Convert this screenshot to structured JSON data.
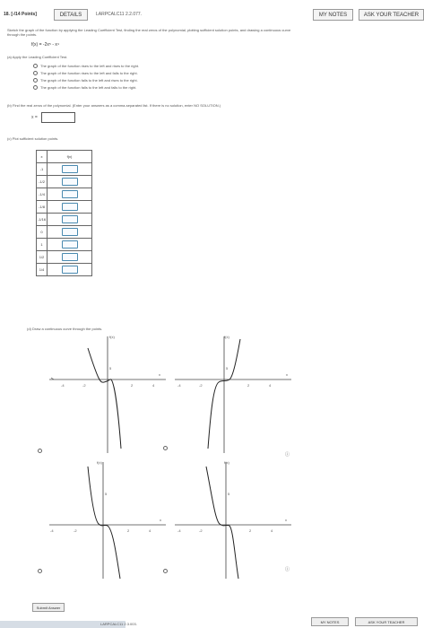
{
  "header": {
    "question_number": "18. [-/14 Points]",
    "details_label": "DETAILS",
    "problem_id": "LARPCALC11 2.2.077.",
    "my_notes_label": "MY NOTES",
    "ask_teacher_label": "ASK YOUR TEACHER"
  },
  "prompt": {
    "line1": "Sketch the graph of the function by applying the Leading Coefficient Test, finding the real zeros of the polynomial, plotting sufficient solution points, and drawing a continuous curve",
    "line2": "through the points.",
    "function": "f(x) = -2x⁵ - x⁴"
  },
  "part_a": {
    "label": "(a)  Apply the Leading Coefficient Test.",
    "options": [
      "The graph of the function rises to the left and rises to the right.",
      "The graph of the function rises to the left and falls to the right.",
      "The graph of the function falls to the left and rises to the right.",
      "The graph of the function falls to the left and falls to the right."
    ]
  },
  "part_b": {
    "label": "(b)  Find the real zeros of the polynomial. (Enter your answers as a comma-separated list. If there is no solution, enter NO SOLUTION.)",
    "x_label": "x ="
  },
  "part_c": {
    "label": "(c)  Plot sufficient solution points.",
    "col_x": "x",
    "col_f": "f(x)",
    "x_values": [
      "-1",
      "-1/2",
      "-1/4",
      "-1/8",
      "-1/16",
      "0",
      "1",
      "1/2",
      "1/4"
    ]
  },
  "part_d": {
    "label": "(d)  Draw a continuous curve through the points.",
    "graphs": [
      {
        "ylabel": "f(x)",
        "y_tick": "5",
        "x_ticks": [
          "-4",
          "-2",
          "2",
          "4"
        ],
        "x_axis_label": "x"
      },
      {
        "ylabel": "f(x)",
        "y_tick": "5",
        "x_ticks": [
          "-4",
          "-2",
          "2",
          "4"
        ],
        "x_axis_label": "x"
      },
      {
        "ylabel": "f(x)",
        "y_tick": "5",
        "x_ticks": [
          "-4",
          "-2",
          "2",
          "4"
        ],
        "x_axis_label": "x"
      },
      {
        "ylabel": "f(x)",
        "y_tick": "5",
        "x_ticks": [
          "-4",
          "-2",
          "2",
          "4"
        ],
        "x_axis_label": "x"
      }
    ]
  },
  "footer": {
    "submit_label": "Submit Answer",
    "next_problem_id": "LARPCALC11 2.3.003.",
    "my_notes_label": "MY NOTES",
    "ask_teacher_label": "ASK YOUR TEACHER"
  }
}
